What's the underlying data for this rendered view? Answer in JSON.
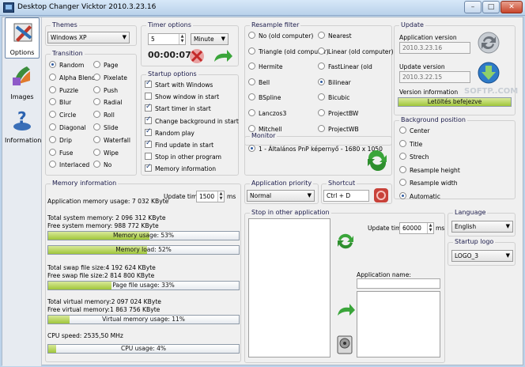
{
  "window": {
    "title": "Desktop Changer Vicktor 2010.3.23.16",
    "min": "–",
    "max": "□",
    "close": "✕"
  },
  "nav": [
    {
      "label": "Options"
    },
    {
      "label": "Images"
    },
    {
      "label": "Information"
    }
  ],
  "themes": {
    "title": "Themes",
    "value": "Windows XP"
  },
  "transition": {
    "title": "Transition",
    "left": [
      "Random",
      "Alpha Blend",
      "Puzzle",
      "Blur",
      "Circle",
      "Diagonal",
      "Drip",
      "Fuse",
      "Interlaced"
    ],
    "right": [
      "Page",
      "Pixelate",
      "Push",
      "Radial",
      "Roll",
      "Slide",
      "Waterfall",
      "Wipe",
      "No"
    ],
    "selected": "Random"
  },
  "timer": {
    "title": "Timer options",
    "value": "5",
    "unit": "Minute",
    "countdown": "00:00:07"
  },
  "startup": {
    "title": "Startup options",
    "items": [
      {
        "label": "Start with Windows",
        "checked": true
      },
      {
        "label": "Show window in start",
        "checked": false
      },
      {
        "label": "Start timer in start",
        "checked": true
      },
      {
        "label": "Change background in start",
        "checked": true
      },
      {
        "label": "Random play",
        "checked": true
      },
      {
        "label": "Find update in start",
        "checked": true
      },
      {
        "label": "Stop in other program",
        "checked": false
      },
      {
        "label": "Memory information",
        "checked": true
      }
    ]
  },
  "resample": {
    "title": "Resample filter",
    "left": [
      "No (old computer)",
      "Triangle (old computer)",
      "Hermite",
      "Bell",
      "BSpline",
      "Lanczos3",
      "Mitchell"
    ],
    "right": [
      "Nearest",
      "Linear (old computer)",
      "FastLinear (old",
      "Bilinear",
      "Bicubic",
      "ProjectBW",
      "ProjectWB"
    ],
    "selected": "Bilinear"
  },
  "monitor": {
    "title": "Monitor",
    "item": "1 - Általános PnP képernyő - 1680 x 1050"
  },
  "update": {
    "title": "Update",
    "app_version_label": "Application version",
    "app_version": "2010.3.23.16",
    "update_version_label": "Update version",
    "update_version": "2010.3.22.15",
    "version_info_label": "Version information",
    "progress_text": "Letöltés befejezve",
    "progress": 1.0,
    "watermark": "SOFTP..COM"
  },
  "background": {
    "title": "Background position",
    "items": [
      "Center",
      "Title",
      "Strech",
      "Resample height",
      "Resample width",
      "Automatic"
    ],
    "selected": "Automatic"
  },
  "memory": {
    "title": "Memory information",
    "app_usage": "Application memory usage: 7 032 KByte",
    "update_time_label": "Update time:",
    "update_time": "1500",
    "unit": "ms",
    "total_system": "Total system memory: 2 096 312 KByte",
    "free_system": "Free system memory: 988 772 KByte",
    "bars": [
      {
        "label": "Memory usage: 53%",
        "value": 0.53
      },
      {
        "label": "Memory load: 52%",
        "value": 0.52
      }
    ],
    "total_swap": "Total swap file size:4 192 624 KByte",
    "free_swap": "Free swap file size:2 814 800 KByte",
    "swap_bar": {
      "label": "Page file usage: 33%",
      "value": 0.33
    },
    "total_virtual": "Total virtual memory:2 097 024 KByte",
    "free_virtual": "Free virtual memory:1 863 756 KByte",
    "virtual_bar": {
      "label": "Virtual memory usage: 11%",
      "value": 0.11
    },
    "cpu_speed": "CPU speed: 2535,50 MHz",
    "cpu_bar": {
      "label": "CPU usage: 4%",
      "value": 0.04
    }
  },
  "priority": {
    "title": "Application priority",
    "value": "Normal"
  },
  "shortcut": {
    "title": "Shortcut",
    "value": "Ctrl + D"
  },
  "stop": {
    "title": "Stop in other application",
    "update_time_label": "Update time:",
    "update_time": "60000",
    "unit": "ms",
    "app_name_label": "Application name:"
  },
  "language": {
    "title": "Language",
    "value": "English"
  },
  "logo": {
    "title": "Startup logo",
    "value": "LOGO_3"
  },
  "colors": {
    "progress_fill": "#a0c63a",
    "title_bar": "#c9ddf2",
    "accent": "#2d5aa0"
  }
}
